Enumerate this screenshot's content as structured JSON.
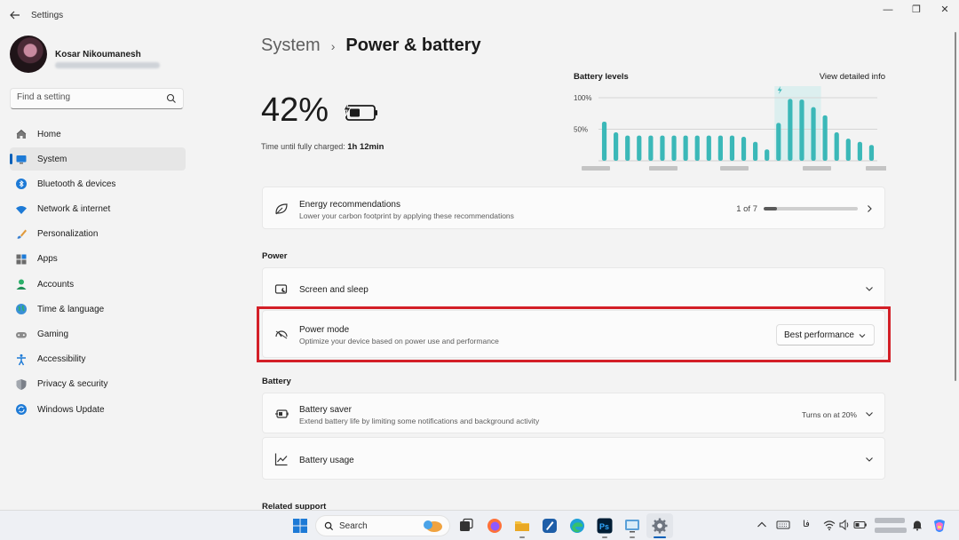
{
  "window": {
    "title": "Settings",
    "controls": [
      "—",
      "❐",
      "✕"
    ]
  },
  "profile": {
    "name": "Kosar Nikoumanesh"
  },
  "search": {
    "placeholder": "Find a setting"
  },
  "sidebar": {
    "items": [
      {
        "label": "Home",
        "icon": "home-icon",
        "active": false
      },
      {
        "label": "System",
        "icon": "system-icon",
        "active": true
      },
      {
        "label": "Bluetooth & devices",
        "icon": "bluetooth-icon",
        "active": false
      },
      {
        "label": "Network & internet",
        "icon": "wifi-icon",
        "active": false
      },
      {
        "label": "Personalization",
        "icon": "brush-icon",
        "active": false
      },
      {
        "label": "Apps",
        "icon": "apps-icon",
        "active": false
      },
      {
        "label": "Accounts",
        "icon": "person-icon",
        "active": false
      },
      {
        "label": "Time & language",
        "icon": "globe-icon",
        "active": false
      },
      {
        "label": "Gaming",
        "icon": "gamepad-icon",
        "active": false
      },
      {
        "label": "Accessibility",
        "icon": "accessibility-icon",
        "active": false
      },
      {
        "label": "Privacy & security",
        "icon": "shield-icon",
        "active": false
      },
      {
        "label": "Windows Update",
        "icon": "sync-icon",
        "active": false
      }
    ]
  },
  "breadcrumb": {
    "parent": "System",
    "separator": "›",
    "current": "Power & battery"
  },
  "battery": {
    "percent": "42%",
    "charge_label": "Time until fully charged:",
    "charge_time": "1h 12min"
  },
  "chart_data": {
    "type": "bar",
    "title": "Battery levels",
    "link": "View detailed info",
    "y_ticks": [
      "100%",
      "50%"
    ],
    "ylim": [
      0,
      100
    ],
    "values": [
      62,
      45,
      40,
      40,
      40,
      40,
      40,
      40,
      40,
      40,
      40,
      40,
      38,
      30,
      18,
      60,
      98,
      97,
      85,
      72,
      45,
      35,
      30,
      25
    ],
    "charging_index": 16
  },
  "energy": {
    "title": "Energy recommendations",
    "subtitle": "Lower your carbon footprint by applying these recommendations",
    "progress_text": "1 of 7",
    "progress_fraction": 0.14
  },
  "power_section": {
    "label": "Power",
    "screen_sleep": {
      "title": "Screen and sleep"
    },
    "power_mode": {
      "title": "Power mode",
      "subtitle": "Optimize your device based on power use and performance",
      "selected": "Best performance"
    }
  },
  "battery_section": {
    "label": "Battery",
    "saver": {
      "title": "Battery saver",
      "subtitle": "Extend battery life by limiting some notifications and background activity",
      "status": "Turns on at 20%"
    },
    "usage": {
      "title": "Battery usage"
    }
  },
  "related": {
    "label": "Related support"
  },
  "taskbar": {
    "search_label": "Search",
    "language": "فا"
  },
  "colors": {
    "accent": "#005fb8",
    "chart_bar": "#3bb8b8",
    "highlight": "#d31f27"
  }
}
